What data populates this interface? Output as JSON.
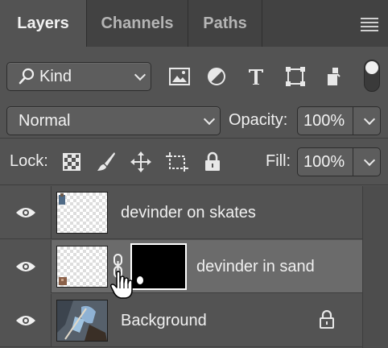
{
  "tabs": [
    {
      "label": "Layers",
      "active": true
    },
    {
      "label": "Channels",
      "active": false
    },
    {
      "label": "Paths",
      "active": false
    }
  ],
  "filter": {
    "kind_label": "Kind",
    "icons": [
      "image-filter-icon",
      "adjustment-filter-icon",
      "type-filter-icon",
      "shape-filter-icon",
      "smart-object-filter-icon"
    ]
  },
  "blend": {
    "mode": "Normal",
    "opacity_label": "Opacity:",
    "opacity_value": "100%"
  },
  "lock": {
    "label": "Lock:",
    "fill_label": "Fill:",
    "fill_value": "100%"
  },
  "layers": [
    {
      "name": "devinder on skates",
      "visible": true,
      "selected": false,
      "has_mask": false
    },
    {
      "name": "devinder in sand",
      "visible": true,
      "selected": true,
      "has_mask": true
    },
    {
      "name": "Background",
      "visible": true,
      "selected": false,
      "locked": true
    }
  ],
  "colors": {
    "panel_bg": "#535353",
    "tabbar_bg": "#424242",
    "selected_layer_bg": "#6b6b6b"
  }
}
